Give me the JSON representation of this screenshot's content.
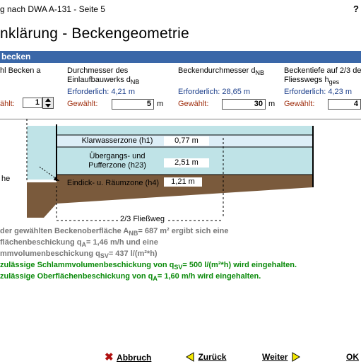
{
  "window": {
    "title": "g nach DWA A-131 - Seite 5",
    "help": "?"
  },
  "page": {
    "heading": "nklärung - Beckengeometrie"
  },
  "section": {
    "label": "becken"
  },
  "fields": {
    "count": {
      "label": "hl Becken a",
      "chosen_label": "ählt:",
      "value": "1"
    },
    "inlet": {
      "label_line1": "Durchmesser des",
      "label_line2": "Einlaufbauwerks d",
      "label_sub": "NB",
      "required": "Erforderlich:  4,21 m",
      "chosen_label": "Gewählt:",
      "value": "5",
      "unit": "m"
    },
    "basin": {
      "label": "Beckendurchmesser d",
      "label_sub": "NB",
      "required": "Erforderlich: 28,65 m",
      "chosen_label": "Gewählt:",
      "value": "30",
      "unit": "m"
    },
    "depth": {
      "label_line1": "Beckentiefe auf 2/3 de",
      "label_line2": "Fliesswegs h",
      "label_sub": "ges",
      "required": "Erforderlich:  4,23 m",
      "chosen_label": "Gewählt:",
      "value": "4"
    }
  },
  "diagram": {
    "side_label": "he",
    "zone1": {
      "name": "Klarwasserzone (h1)",
      "value": "0,77 m"
    },
    "zone2": {
      "name_line1": "Übergangs- und",
      "name_line2": "Pufferzone (h23)",
      "value": "2,51 m"
    },
    "zone3": {
      "name": "Eindick- u. Räumzone (h4)",
      "value": "1,21 m"
    },
    "flow_label": "2/3 Fließweg",
    "colors": {
      "water": "#bfe3e7",
      "clear": "#ddeef7",
      "sludge": "#7a5a3c"
    }
  },
  "results": {
    "line1_pre": "der gewählten Beckenoberfläche A",
    "line1_sub": "NB",
    "line1_post": "=  687 m² ergibt sich eine",
    "line2_pre": "flächenbeschickung q",
    "line2_sub": "A",
    "line2_post": "= 1,46 m/h und eine",
    "line3_pre": "mmvolumenbeschickung q",
    "line3_sub": "SV",
    "line3_post": "=  437 l/(m²*h)",
    "line4_pre": "zulässige Schlammvolumenbeschickung von q",
    "line4_sub": "SV",
    "line4_post": "=  500 l/(m²*h) wird eingehalten.",
    "line5_pre": "zulässige Oberflächenbeschickung von q",
    "line5_sub": "A",
    "line5_post": "= 1,60 m/h wird eingehalten."
  },
  "buttons": {
    "cancel": "Abbruch",
    "back": "Zurück",
    "next": "Weiter",
    "ok": "OK"
  }
}
